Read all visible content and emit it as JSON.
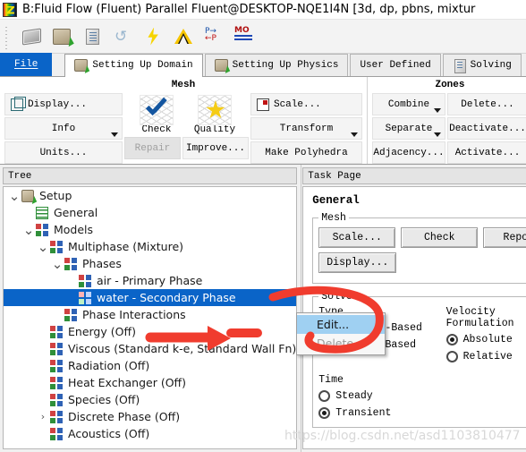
{
  "window": {
    "title": "B:Fluid Flow (Fluent) Parallel Fluent@DESKTOP-NQE1I4N  [3d, dp, pbns, mixtur",
    "app_icon": "fluent-logo-icon"
  },
  "quick_toolbar": {
    "buttons": [
      {
        "name": "read-mesh-icon",
        "label": "mesh"
      },
      {
        "name": "read-case-icon",
        "label": "case"
      },
      {
        "name": "write-case-icon",
        "label": "build"
      },
      {
        "name": "refresh-icon",
        "label": "refresh"
      },
      {
        "name": "initialize-icon",
        "label": "bolt"
      },
      {
        "name": "ansys-logo-icon",
        "label": "ansys"
      },
      {
        "name": "parallel-icon",
        "label": "parallel"
      },
      {
        "name": "monitor-icon",
        "label": "monitors"
      }
    ]
  },
  "ribbon": {
    "tabs": [
      {
        "label": "File",
        "icon": "",
        "state": "file"
      },
      {
        "label": "Setting Up Domain",
        "icon": "case-icon",
        "state": "active"
      },
      {
        "label": "Setting Up Physics",
        "icon": "case-icon",
        "state": "normal"
      },
      {
        "label": "User Defined",
        "icon": "",
        "state": "normal"
      },
      {
        "label": "Solving",
        "icon": "build-icon",
        "state": "normal"
      }
    ],
    "groups": [
      {
        "title": "Mesh",
        "col1": [
          {
            "label": "Display...",
            "icon": "cube-icon",
            "caret": false,
            "disabled": false
          },
          {
            "label": "Info",
            "icon": "",
            "caret": true,
            "disabled": false
          },
          {
            "label": "Units...",
            "icon": "",
            "caret": false,
            "disabled": false
          }
        ],
        "big": [
          {
            "label": "Check",
            "icon": "mesh-check-icon"
          },
          {
            "label": "Quality",
            "icon": "mesh-quality-icon"
          }
        ],
        "under_big": [
          {
            "label": "Repair",
            "disabled": true
          },
          {
            "label": "Improve...",
            "disabled": false
          }
        ],
        "col2": [
          {
            "label": "Scale...",
            "icon": "scale-icon",
            "caret": false,
            "disabled": false
          },
          {
            "label": "Transform",
            "icon": "",
            "caret": true,
            "disabled": false
          },
          {
            "label": "Make Polyhedra",
            "icon": "",
            "caret": false,
            "disabled": false
          }
        ]
      },
      {
        "title": "Zones",
        "col1": [
          {
            "label": "Combine",
            "caret": true
          },
          {
            "label": "Separate",
            "caret": true
          },
          {
            "label": "Adjacency...",
            "caret": false
          }
        ],
        "col2": [
          {
            "label": "Delete...",
            "caret": false
          },
          {
            "label": "Deactivate...",
            "caret": false
          },
          {
            "label": "Activate...",
            "caret": false
          }
        ]
      }
    ]
  },
  "tree_panel": {
    "header": "Tree",
    "nodes": [
      {
        "label": "Setup",
        "indent": 0,
        "arrow": "down",
        "icon": "setup-icon",
        "selected": false
      },
      {
        "label": "General",
        "indent": 1,
        "arrow": "none",
        "icon": "general-icon",
        "selected": false
      },
      {
        "label": "Models",
        "indent": 1,
        "arrow": "down",
        "icon": "models-icon",
        "selected": false
      },
      {
        "label": "Multiphase (Mixture)",
        "indent": 2,
        "arrow": "down",
        "icon": "models-icon",
        "selected": false
      },
      {
        "label": "Phases",
        "indent": 3,
        "arrow": "down",
        "icon": "models-icon",
        "selected": false
      },
      {
        "label": "air - Primary Phase",
        "indent": 4,
        "arrow": "none",
        "icon": "models-icon",
        "selected": false
      },
      {
        "label": "water - Secondary Phase",
        "indent": 4,
        "arrow": "none",
        "icon": "models-icon",
        "selected": true
      },
      {
        "label": "Phase Interactions",
        "indent": 3,
        "arrow": "none",
        "icon": "models-icon",
        "selected": false
      },
      {
        "label": "Energy (Off)",
        "indent": 2,
        "arrow": "none",
        "icon": "models-icon",
        "selected": false
      },
      {
        "label": "Viscous (Standard k-e, Standard Wall Fn)",
        "indent": 2,
        "arrow": "none",
        "icon": "models-icon",
        "selected": false
      },
      {
        "label": "Radiation (Off)",
        "indent": 2,
        "arrow": "none",
        "icon": "models-icon",
        "selected": false
      },
      {
        "label": "Heat Exchanger (Off)",
        "indent": 2,
        "arrow": "none",
        "icon": "models-icon",
        "selected": false
      },
      {
        "label": "Species (Off)",
        "indent": 2,
        "arrow": "none",
        "icon": "models-icon",
        "selected": false
      },
      {
        "label": "Discrete Phase (Off)",
        "indent": 2,
        "arrow": "right",
        "icon": "models-icon",
        "selected": false
      },
      {
        "label": "Acoustics (Off)",
        "indent": 2,
        "arrow": "none",
        "icon": "models-icon",
        "selected": false
      }
    ]
  },
  "context_menu": {
    "items": [
      {
        "label": "Edit...",
        "highlighted": true,
        "disabled": false
      },
      {
        "label": "Delete",
        "highlighted": false,
        "disabled": true
      }
    ]
  },
  "task_page": {
    "header": "Task Page",
    "title": "General",
    "mesh": {
      "legend": "Mesh",
      "buttons_row1": [
        "Scale...",
        "Check",
        "Report"
      ],
      "buttons_row2": [
        "Display..."
      ]
    },
    "solver": {
      "legend": "Solver",
      "type_label": "Type",
      "type_options": [
        {
          "label": "Pressure-Based",
          "selected": true
        },
        {
          "label": "Density-Based",
          "selected": false
        }
      ],
      "velocity_label": "Velocity Formulation",
      "velocity_options": [
        {
          "label": "Absolute",
          "selected": true
        },
        {
          "label": "Relative",
          "selected": false
        }
      ],
      "time_label": "Time",
      "time_options": [
        {
          "label": "Steady",
          "selected": false
        },
        {
          "label": "Transient",
          "selected": true
        }
      ]
    }
  },
  "watermark": {
    "text": "https://blog.csdn.net/asd1103810477"
  },
  "colors": {
    "selection_blue": "#0a64c8",
    "file_tab_blue": "#0a64c8",
    "menu_highlight": "#9fd0f2",
    "annotation_red": "#f03c2e"
  }
}
